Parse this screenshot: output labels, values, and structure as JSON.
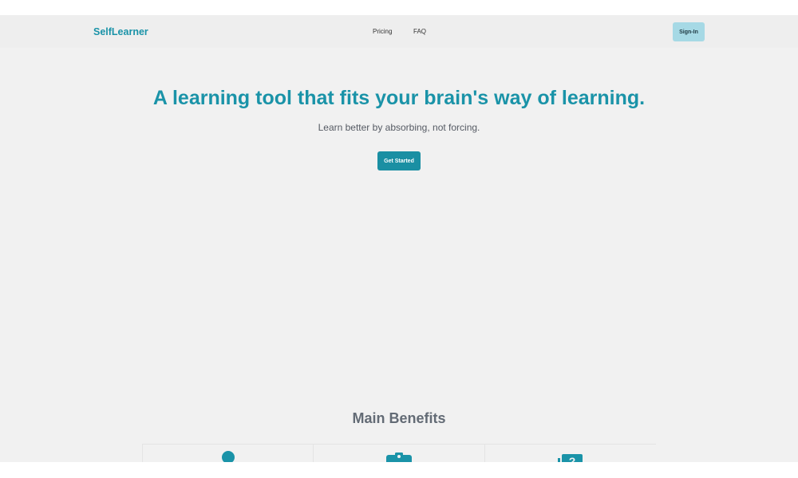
{
  "header": {
    "logo_text": "SelfLearner",
    "nav": [
      {
        "label": "Pricing"
      },
      {
        "label": "FAQ"
      }
    ],
    "signin_label": "Sign-In"
  },
  "hero": {
    "title": "A learning tool that fits your brain's way of learning.",
    "subtitle": "Learn better by absorbing, not forcing.",
    "cta_label": "Get Started"
  },
  "benefits": {
    "title": "Main Benefits",
    "cards": [
      {
        "icon": "person-icon"
      },
      {
        "icon": "briefcase-icon"
      },
      {
        "icon": "question-icon"
      }
    ]
  },
  "colors": {
    "brand": "#1a93a8",
    "signin_bg": "#a6d9e5",
    "page_bg": "#f1f1f1",
    "nav_bg": "#eeeeee"
  }
}
